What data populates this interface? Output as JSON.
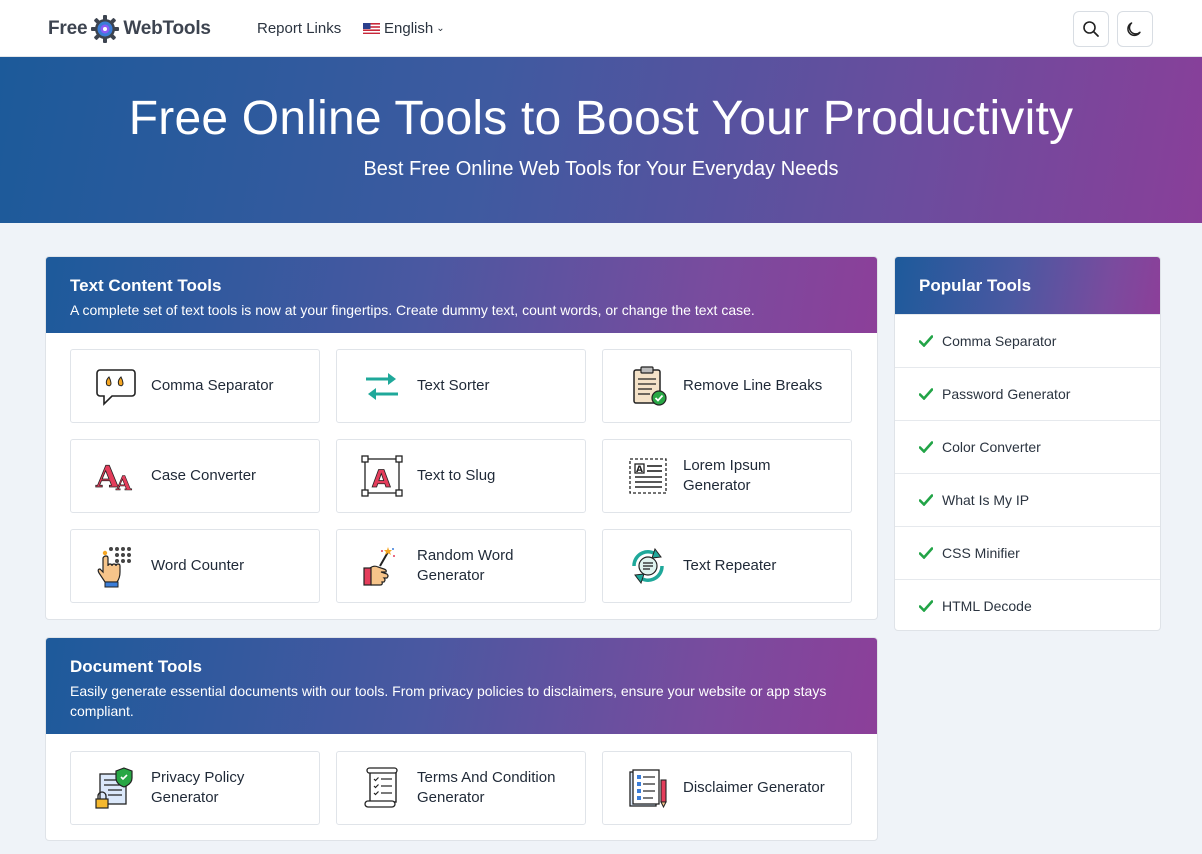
{
  "navbar": {
    "logo_left": "Free",
    "logo_right": "WebTools",
    "report_links": "Report Links",
    "language": "English"
  },
  "hero": {
    "title": "Free Online Tools to Boost Your Productivity",
    "subtitle": "Best Free Online Web Tools for Your Everyday Needs"
  },
  "text_tools": {
    "title": "Text Content Tools",
    "description": "A complete set of text tools is now at your fingertips. Create dummy text, count words, or change the text case.",
    "items": [
      {
        "label": "Comma Separator",
        "icon": "speech-bubble-icon"
      },
      {
        "label": "Text Sorter",
        "icon": "swap-arrows-icon"
      },
      {
        "label": "Remove Line Breaks",
        "icon": "clipboard-check-icon"
      },
      {
        "label": "Case Converter",
        "icon": "font-case-icon"
      },
      {
        "label": "Text to Slug",
        "icon": "text-box-icon"
      },
      {
        "label": "Lorem Ipsum Generator",
        "icon": "text-lines-icon"
      },
      {
        "label": "Word Counter",
        "icon": "hand-count-icon"
      },
      {
        "label": "Random Word Generator",
        "icon": "magic-hand-icon"
      },
      {
        "label": "Text Repeater",
        "icon": "repeat-icon"
      }
    ]
  },
  "document_tools": {
    "title": "Document Tools",
    "description": "Easily generate essential documents with our tools. From privacy policies to disclaimers, ensure your website or app stays compliant.",
    "items": [
      {
        "label": "Privacy Policy Generator",
        "icon": "privacy-lock-icon"
      },
      {
        "label": "Terms And Condition Generator",
        "icon": "scroll-document-icon"
      },
      {
        "label": "Disclaimer Generator",
        "icon": "notepad-pencil-icon"
      }
    ]
  },
  "popular": {
    "title": "Popular Tools",
    "items": [
      "Comma Separator",
      "Password Generator",
      "Color Converter",
      "What Is My IP",
      "CSS Minifier",
      "HTML Decode"
    ]
  },
  "colors": {
    "gradient_start": "#1c5a9a",
    "gradient_end": "#893f99",
    "check_green": "#22a447",
    "page_bg": "#eff3f8"
  }
}
